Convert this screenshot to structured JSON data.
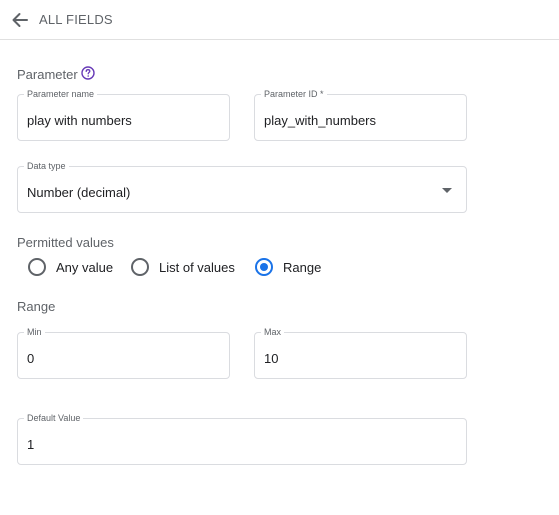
{
  "header": {
    "title": "ALL FIELDS",
    "back_icon": "arrow-left-icon"
  },
  "parameter": {
    "section_label": "Parameter",
    "help_icon": "help-circle-icon",
    "name_field": {
      "label": "Parameter name",
      "value": "play with numbers"
    },
    "id_field": {
      "label": "Parameter ID *",
      "value": "play_with_numbers"
    }
  },
  "data_type": {
    "label": "Data type",
    "value": "Number (decimal)",
    "arrow_icon": "dropdown-arrow-icon"
  },
  "permitted_values": {
    "section_label": "Permitted values",
    "options": [
      {
        "label": "Any value",
        "checked": false
      },
      {
        "label": "List of values",
        "checked": false
      },
      {
        "label": "Range",
        "checked": true
      }
    ]
  },
  "range": {
    "section_label": "Range",
    "min": {
      "label": "Min",
      "value": "0"
    },
    "max": {
      "label": "Max",
      "value": "10"
    }
  },
  "default_value": {
    "label": "Default Value",
    "value": "1"
  },
  "colors": {
    "accent": "#1a73e8",
    "help_icon": "#673ab7",
    "border": "#dadce0",
    "secondary_text": "#5f6368"
  }
}
